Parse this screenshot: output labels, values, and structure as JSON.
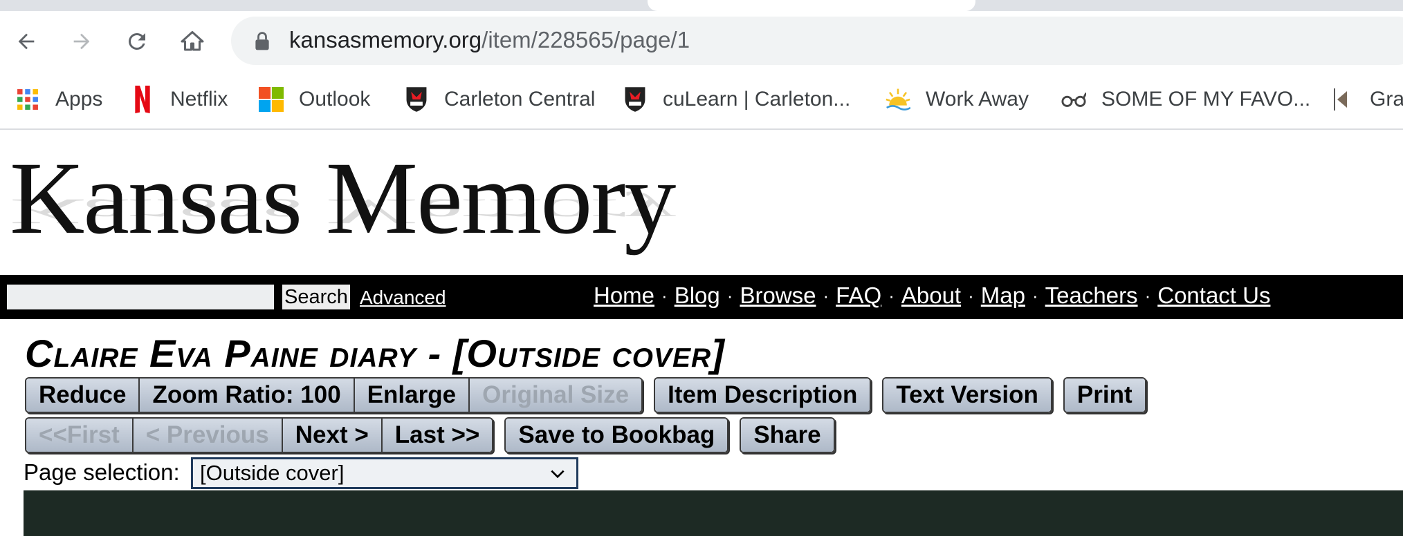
{
  "browser": {
    "url_domain": "kansasmemory.org",
    "url_path": "/item/228565/page/1",
    "bookmarks": [
      {
        "label": "Apps",
        "icon": "apps-grid-icon"
      },
      {
        "label": "Netflix",
        "icon": "netflix-icon"
      },
      {
        "label": "Outlook",
        "icon": "microsoft-logo-icon"
      },
      {
        "label": "Carleton Central",
        "icon": "carleton-shield-icon"
      },
      {
        "label": "cuLearn | Carleton...",
        "icon": "carleton-shield-icon"
      },
      {
        "label": "Work Away",
        "icon": "sun-icon"
      },
      {
        "label": "SOME OF MY FAVO...",
        "icon": "glasses-icon"
      },
      {
        "label": "Grap",
        "icon": "bookmark-arrow-icon"
      }
    ]
  },
  "site": {
    "logo_text": "Kansas Memory",
    "search_button": "Search",
    "advanced_link": "Advanced",
    "nav": [
      "Home",
      "Blog",
      "Browse",
      "FAQ",
      "About",
      "Map",
      "Teachers",
      "Contact Us"
    ],
    "nav_separator": "·"
  },
  "item": {
    "title": "Claire Eva Paine diary - [Outside cover]",
    "toolbar1_group1": [
      "Reduce",
      "Zoom Ratio: 100",
      "Enlarge",
      "Original Size"
    ],
    "toolbar1_singles": [
      "Item Description",
      "Text Version",
      "Print"
    ],
    "toolbar2_group1": [
      "<<First",
      "< Previous",
      "Next >",
      "Last >>"
    ],
    "toolbar2_singles": [
      "Save to Bookbag",
      "Share"
    ],
    "page_selection_label": "Page selection:",
    "page_selection_value": "[Outside cover]"
  },
  "colors": {
    "nav_bar": "#000000",
    "button_gradient_top": "#d4dbe5",
    "button_gradient_bottom": "#aeb9c8",
    "disabled_text": "#9ea6b0"
  }
}
